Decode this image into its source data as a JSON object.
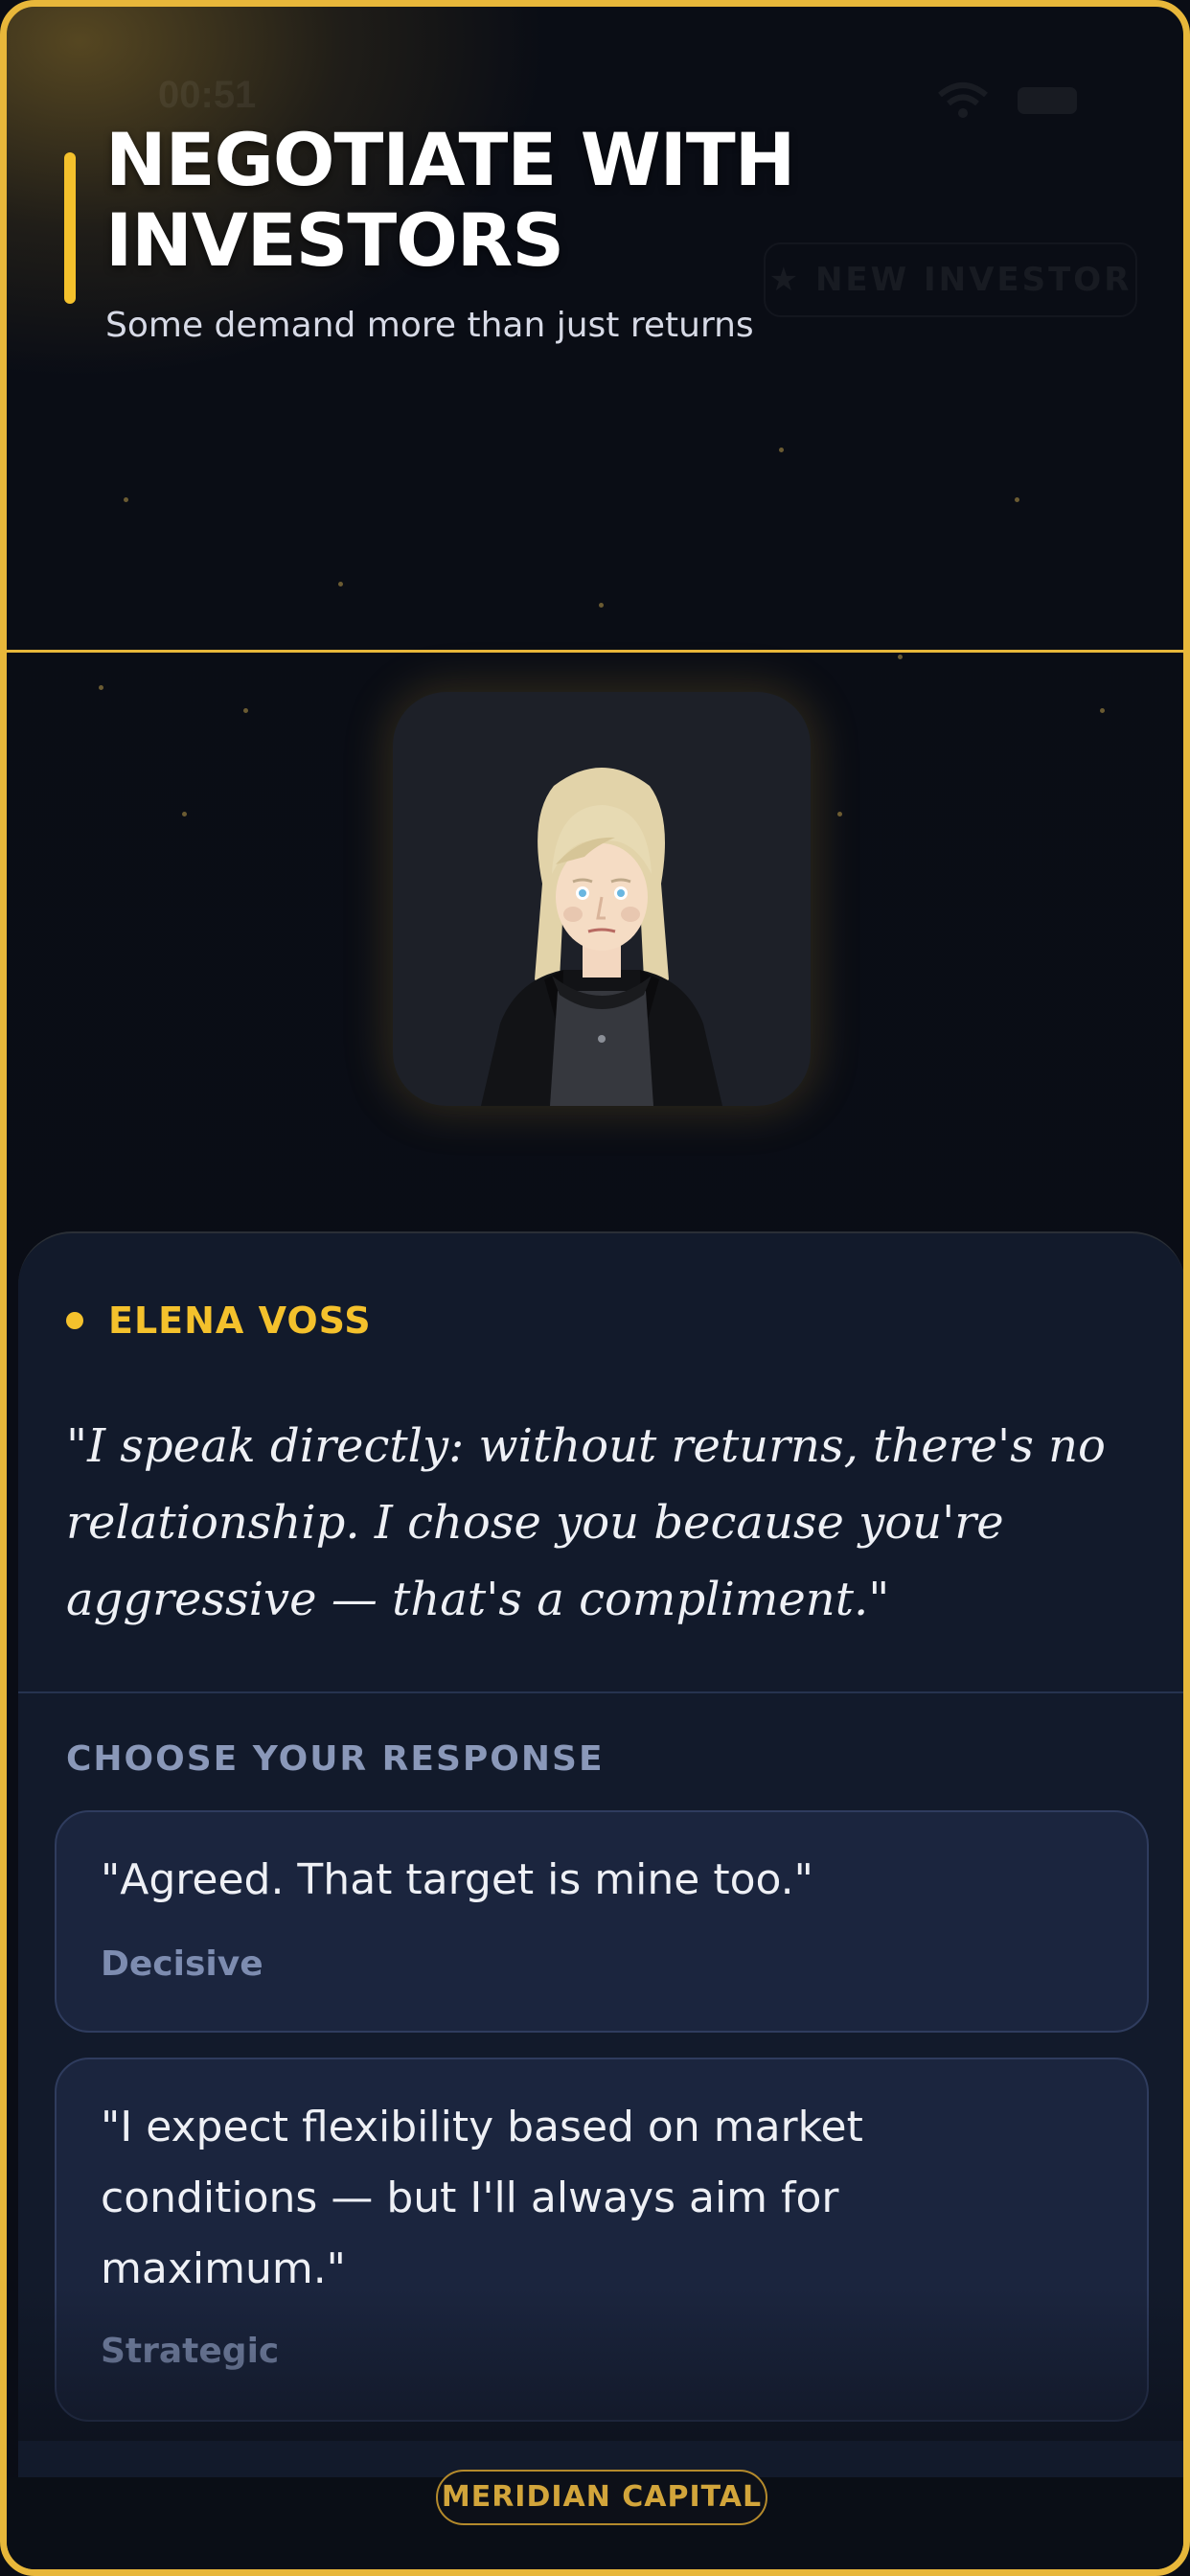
{
  "header": {
    "title": "NEGOTIATE WITH INVESTORS",
    "subtitle": "Some demand more than just returns"
  },
  "status_bar": {
    "time": "00:51"
  },
  "ghost_button_label": "★ NEW INVESTOR",
  "portrait": {
    "icon": "investor-portrait"
  },
  "dialogue": {
    "speaker": "ELENA VOSS",
    "quote": "\"I speak directly: without returns, there's no relationship. I chose you because you're aggressive — that's a compliment.\""
  },
  "responses": {
    "label": "CHOOSE YOUR RESPONSE",
    "options": [
      {
        "text": "\"Agreed. That target is mine too.\"",
        "tag": "Decisive"
      },
      {
        "text": "\"I expect flexibility based on market conditions — but I'll always aim for maximum.\"",
        "tag": "Strategic"
      }
    ]
  },
  "footer": {
    "brand": "MERIDIAN CAPITAL"
  },
  "colors": {
    "accent": "#f4c12c",
    "frame": "#e8b73a",
    "panel": "#121a2b",
    "option_bg": "#1b253e"
  }
}
